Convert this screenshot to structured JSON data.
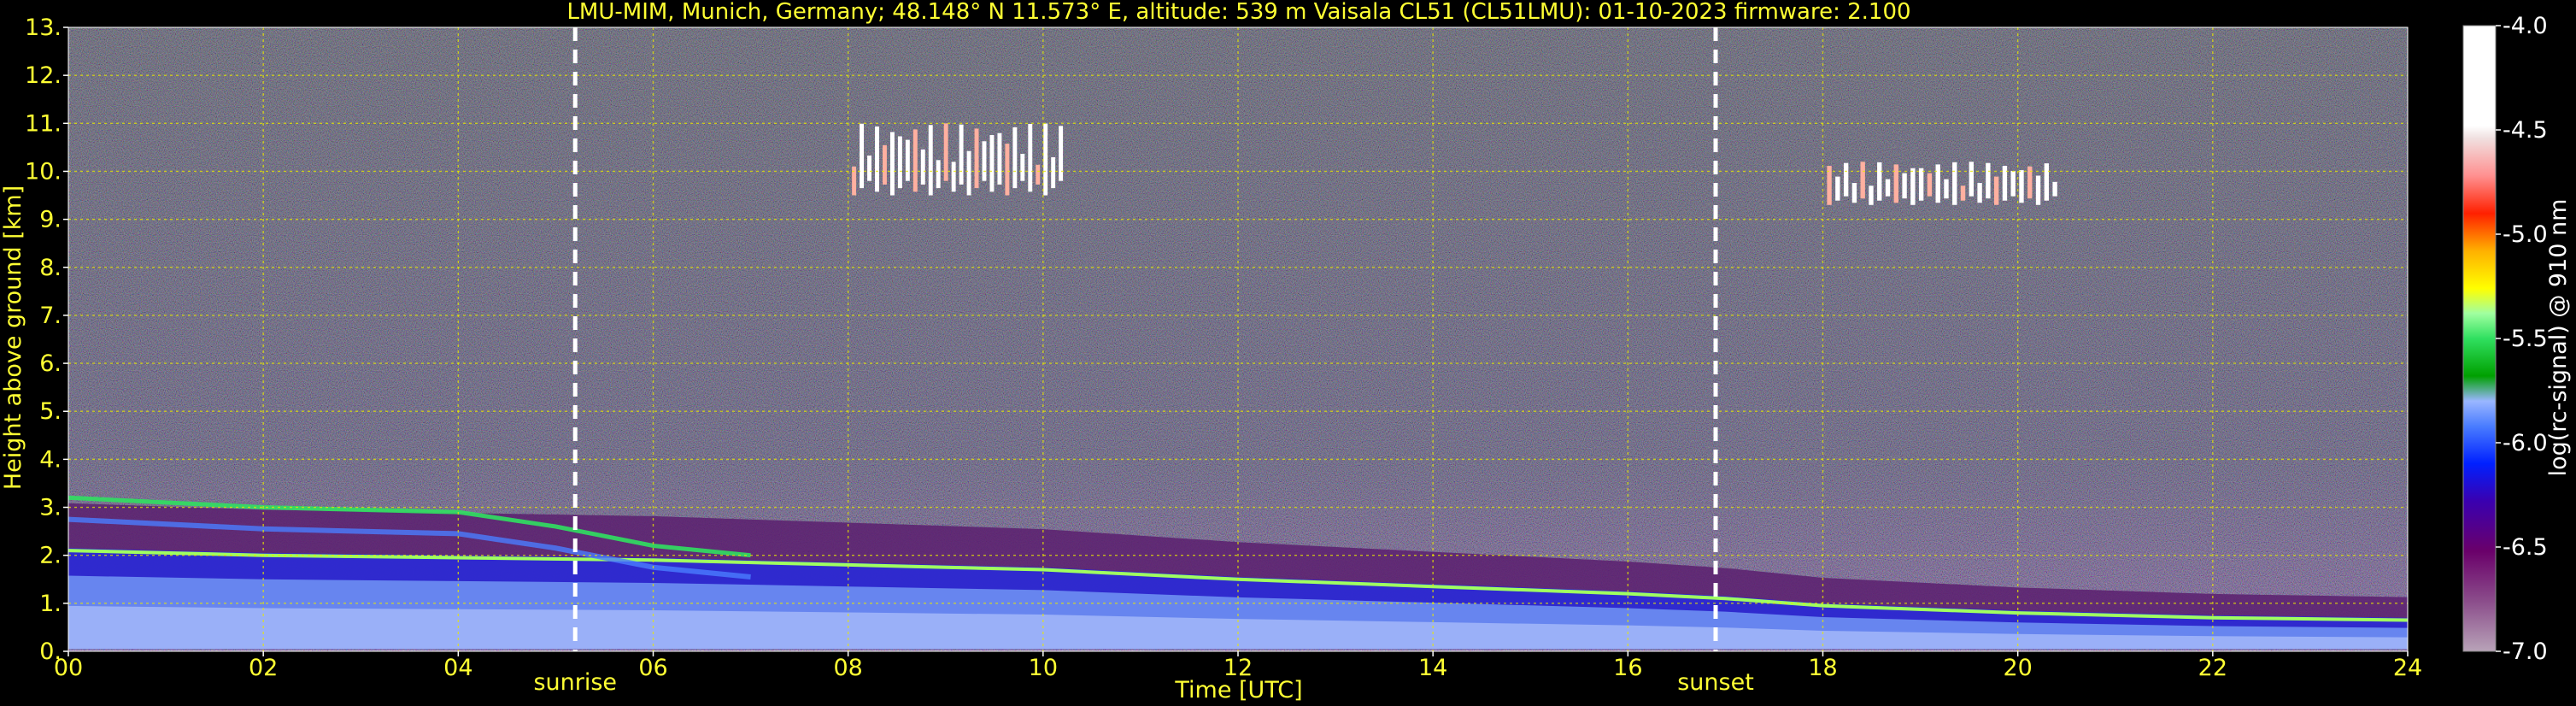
{
  "chart_data": {
    "type": "heatmap",
    "title": "LMU-MIM, Munich, Germany; 48.148° N 11.573° E, altitude: 539 m    Vaisala CL51 (CL51LMU): 01-10-2023    firmware: 2.100",
    "xlabel": "Time [UTC]",
    "ylabel": "Height above ground [km]",
    "xlim": [
      0,
      24
    ],
    "ylim": [
      0,
      13
    ],
    "x_tick_labels": [
      "00",
      "02",
      "04",
      "06",
      "08",
      "10",
      "12",
      "14",
      "16",
      "18",
      "20",
      "22",
      "24"
    ],
    "y_tick_labels": [
      "0.",
      "1.",
      "2.",
      "3.",
      "4.",
      "5.",
      "6.",
      "7.",
      "8.",
      "9.",
      "10.",
      "11.",
      "12.",
      "13."
    ],
    "grid": true,
    "colorbar": {
      "label": "log(rc-signal) @ 910 nm",
      "range": [
        -7.0,
        -4.0
      ],
      "tick_labels": [
        "-4.0",
        "-4.5",
        "-5.0",
        "-5.5",
        "-6.0",
        "-6.5",
        "-7.0"
      ]
    },
    "annotations": [
      {
        "x": 5.2,
        "label": "sunrise"
      },
      {
        "x": 16.9,
        "label": "sunset"
      }
    ],
    "boundary_layer_top_km": [
      {
        "x": 0,
        "y": 2.1
      },
      {
        "x": 2,
        "y": 2.0
      },
      {
        "x": 4,
        "y": 1.95
      },
      {
        "x": 6,
        "y": 1.9
      },
      {
        "x": 8,
        "y": 1.8
      },
      {
        "x": 10,
        "y": 1.7
      },
      {
        "x": 12,
        "y": 1.5
      },
      {
        "x": 14,
        "y": 1.35
      },
      {
        "x": 16,
        "y": 1.2
      },
      {
        "x": 17,
        "y": 1.1
      },
      {
        "x": 18,
        "y": 0.95
      },
      {
        "x": 20,
        "y": 0.8
      },
      {
        "x": 22,
        "y": 0.7
      },
      {
        "x": 24,
        "y": 0.65
      }
    ],
    "residual_layer_top_km": [
      {
        "x": 0,
        "y": 3.2
      },
      {
        "x": 2,
        "y": 3.0
      },
      {
        "x": 4,
        "y": 2.9
      },
      {
        "x": 5,
        "y": 2.6
      },
      {
        "x": 6,
        "y": 2.2
      },
      {
        "x": 7,
        "y": 2.0
      }
    ],
    "cirrus_clouds_km": [
      {
        "x_start": 8.0,
        "x_end": 10.2,
        "y_bottom": 9.5,
        "y_top": 11.0
      },
      {
        "x_start": 18.0,
        "x_end": 20.4,
        "y_bottom": 9.3,
        "y_top": 10.2
      }
    ]
  },
  "colors": {
    "axis_text": "#ffff33",
    "colorbar_text": "#ffffff",
    "grid": "#e8e800",
    "marker_line": "#ffffff"
  }
}
